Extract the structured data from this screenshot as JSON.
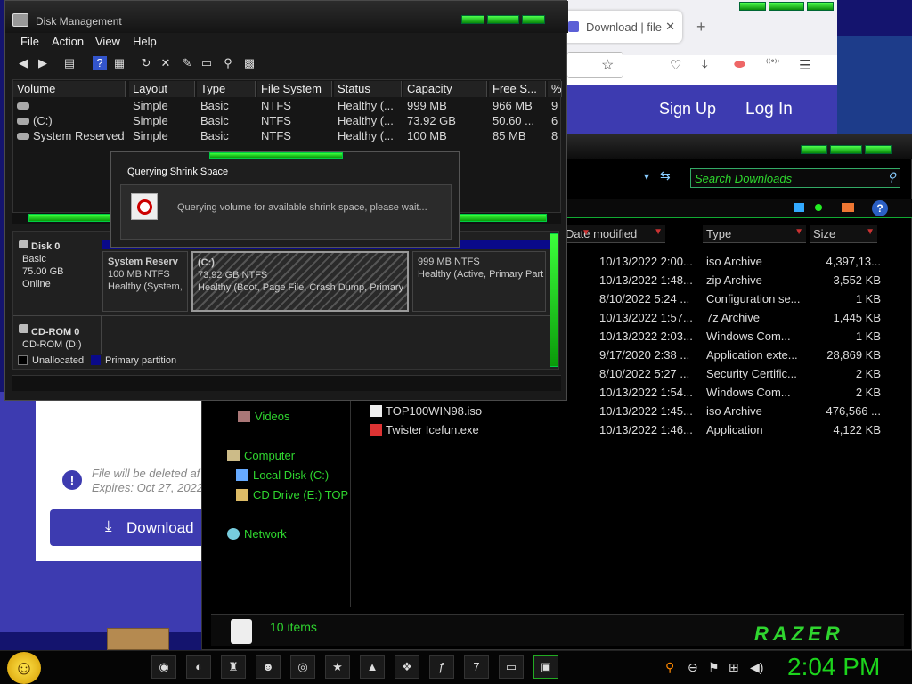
{
  "browser": {
    "tab_title": "Download | file",
    "new_tab": "+",
    "header": {
      "signup": "Sign Up",
      "login": "Log In"
    }
  },
  "website": {
    "info_icon": "!",
    "deleted_text": "File will be deleted af",
    "expires_text": "Expires: Oct 27, 2022",
    "download_button": "Download"
  },
  "explorer": {
    "search_placeholder": "Search Downloads",
    "columns": {
      "date": "Date modified",
      "type": "Type",
      "size": "Size"
    },
    "files": [
      {
        "name": "",
        "date": "10/13/2022 2:00...",
        "type": "iso Archive",
        "size": "4,397,13..."
      },
      {
        "name": "",
        "date": "10/13/2022 1:48...",
        "type": "zip Archive",
        "size": "3,552 KB"
      },
      {
        "name": "",
        "date": "8/10/2022 5:24 ...",
        "type": "Configuration se...",
        "size": "1 KB"
      },
      {
        "name": "",
        "date": "10/13/2022 1:57...",
        "type": "7z Archive",
        "size": "1,445 KB"
      },
      {
        "name": "",
        "date": "10/13/2022 2:03...",
        "type": "Windows Com...",
        "size": "1 KB"
      },
      {
        "name": "",
        "date": "9/17/2020 2:38 ...",
        "type": "Application exte...",
        "size": "28,869 KB"
      },
      {
        "name": "",
        "date": "8/10/2022 5:27 ...",
        "type": "Security Certific...",
        "size": "2 KB"
      },
      {
        "name": "",
        "date": "10/13/2022 1:54...",
        "type": "Windows Com...",
        "size": "2 KB"
      },
      {
        "name": "TOP100WIN98.iso",
        "date": "10/13/2022 1:45...",
        "type": "iso Archive",
        "size": "476,566 ..."
      },
      {
        "name": "Twister Icefun.exe",
        "date": "10/13/2022 1:46...",
        "type": "Application",
        "size": "4,122 KB"
      }
    ],
    "nav": {
      "videos": "Videos",
      "computer": "Computer",
      "local_disk": "Local Disk (C:)",
      "cd_drive": "CD Drive (E:) TOP",
      "network": "Network"
    },
    "status_count": "10 items",
    "brand": "RAZER"
  },
  "disk_mgmt": {
    "title": "Disk Management",
    "menu": [
      "File",
      "Action",
      "View",
      "Help"
    ],
    "columns": [
      "Volume",
      "Layout",
      "Type",
      "File System",
      "Status",
      "Capacity",
      "Free S...",
      "%"
    ],
    "volumes": [
      {
        "volume": "",
        "layout": "Simple",
        "type": "Basic",
        "fs": "NTFS",
        "status": "Healthy (...",
        "capacity": "999 MB",
        "free": "966 MB",
        "pct": "9"
      },
      {
        "volume": "(C:)",
        "layout": "Simple",
        "type": "Basic",
        "fs": "NTFS",
        "status": "Healthy (...",
        "capacity": "73.92 GB",
        "free": "50.60 ...",
        "pct": "6"
      },
      {
        "volume": "System Reserved",
        "layout": "Simple",
        "type": "Basic",
        "fs": "NTFS",
        "status": "Healthy (...",
        "capacity": "100 MB",
        "free": "85 MB",
        "pct": "8"
      }
    ],
    "disk0": {
      "name": "Disk 0",
      "type": "Basic",
      "size": "75.00 GB",
      "state": "Online"
    },
    "cdrom": {
      "name": "CD-ROM 0",
      "drive": "CD-ROM (D:)"
    },
    "partitions": [
      {
        "title": "System Reserv",
        "line1": "100 MB NTFS",
        "line2": "Healthy (System,"
      },
      {
        "title": "(C:)",
        "line1": "73.92 GB NTFS",
        "line2": "Healthy (Boot, Page File, Crash Dump, Primary P"
      },
      {
        "title": "",
        "line1": "999 MB NTFS",
        "line2": "Healthy (Active, Primary Part"
      }
    ],
    "legend": {
      "unallocated": "Unallocated",
      "primary": "Primary partition"
    }
  },
  "dialog": {
    "title": "Querying Shrink Space",
    "message": "Querying volume for available shrink space, please wait..."
  },
  "taskbar": {
    "clock": "2:04 PM"
  }
}
